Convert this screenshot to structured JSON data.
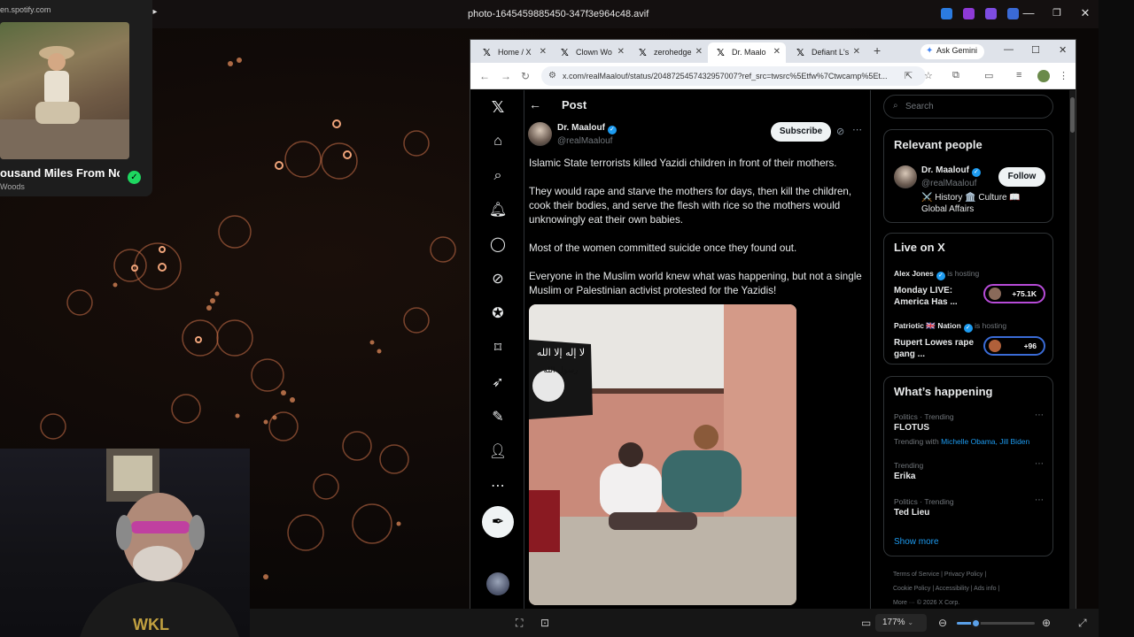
{
  "viewer": {
    "title": "photo-1645459885450-347f3e964c48.avif",
    "zoom": "177%",
    "zoom_level_fraction": 0.24
  },
  "spotify": {
    "url": "en.spotify.com",
    "song": "ousand Miles From No",
    "artist": "Woods"
  },
  "browser": {
    "tabs": [
      {
        "label": "Home / X",
        "active": false
      },
      {
        "label": "Clown Wo",
        "active": false
      },
      {
        "label": "zerohedge",
        "active": false
      },
      {
        "label": "Dr. Maalo",
        "active": true
      },
      {
        "label": "Defiant L's",
        "active": false
      }
    ],
    "gemini_label": "Ask Gemini",
    "url": "x.com/realMaalouf/status/2048725457432957007?ref_src=twsrc%5Etfw%7Ctwcamp%5Et..."
  },
  "post": {
    "header_title": "Post",
    "author_name": "Dr. Maalouf",
    "author_handle": "@realMaalouf",
    "subscribe_label": "Subscribe",
    "paragraphs": [
      "Islamic State terrorists killed Yazidi children in front of their mothers.",
      "They would rape and starve the mothers for days, then kill the children, cook their bodies, and serve the flesh with rice so the mothers would unknowingly eat their own babies.",
      "Most of the women committed suicide once they found out.",
      "Everyone in the Muslim world knew what was happening, but not a single Muslim or Palestinian activist protested for the Yazidis!"
    ],
    "flag_text_line1": "لا إله إلا الله",
    "flag_text_line2": "رسول الله"
  },
  "sidebar": {
    "search_placeholder": "Search",
    "relevant": {
      "title": "Relevant people",
      "name": "Dr. Maalouf",
      "handle": "@realMaalouf",
      "bio": "⚔️ History 🏛️ Culture 📖 Global Affairs",
      "follow_label": "Follow"
    },
    "live": {
      "title": "Live on X",
      "items": [
        {
          "host": "Alex Jones",
          "status": "is hosting",
          "title": "Monday LIVE: America Has ...",
          "count": "+75.1K"
        },
        {
          "host": "Patriotic 🇬🇧 Nation",
          "status": "is hosting",
          "title": "Rupert Lowes rape gang ...",
          "count": "+96"
        }
      ]
    },
    "trending": {
      "title": "What’s happening",
      "items": [
        {
          "category": "Politics · Trending",
          "name": "FLOTUS",
          "with_label": "Trending with",
          "with_links": "Michelle Obama, Jill Biden"
        },
        {
          "category": "Trending",
          "name": "Erika"
        },
        {
          "category": "Politics · Trending",
          "name": "Ted Lieu"
        }
      ],
      "show_more": "Show more"
    },
    "footer": {
      "line1": "Terms of Service  |  Privacy Policy  |",
      "line2": "Cookie Policy  |  Accessibility  |  Ads info  |",
      "line3": "More ···  © 2026 X Corp."
    }
  }
}
